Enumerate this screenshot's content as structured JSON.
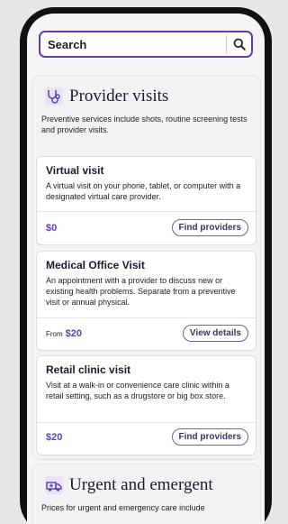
{
  "search": {
    "placeholder": "Search",
    "icon": "magnifier"
  },
  "provider_section": {
    "title": "Provider visits",
    "icon": "stethoscope",
    "description": "Preventive services include shots, routine screening tests and provider visits.",
    "cards": [
      {
        "title": "Virtual visit",
        "description": "A virtual visit on your phone, tablet, or computer with a designated virtual care provider.",
        "price": "$0",
        "action": "Find providers"
      },
      {
        "title": "Medical Office Visit",
        "description": "An appointment with a provider to discuss new or existing health problems. Separate from a preventive visit or annual physical.",
        "price_prefix": "From",
        "price": "$20",
        "action": "View details"
      },
      {
        "title": "Retail clinic visit",
        "description": "Visit at a walk-in or convenience care clinic within a retail setting, such as a drugstore or big box store.",
        "price": "$20",
        "action": "Find providers"
      }
    ]
  },
  "urgent_section": {
    "title": "Urgent and emergent",
    "icon": "ambulance",
    "description": "Prices for urgent and emergency care include"
  },
  "colors": {
    "accent": "#5a3fb6",
    "text": "#1b1b2b",
    "background": "#f5f5f7"
  }
}
